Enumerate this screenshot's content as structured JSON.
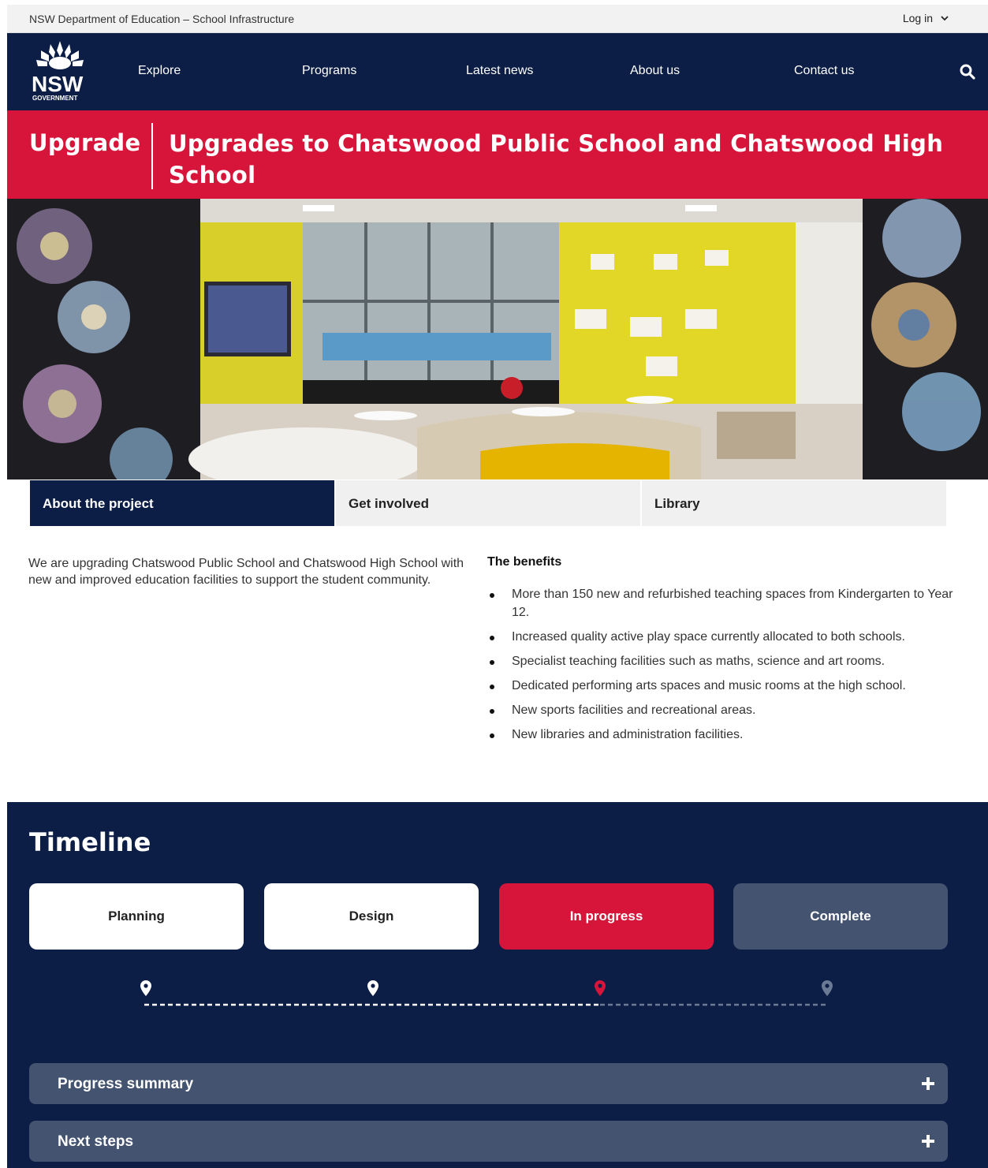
{
  "utility": {
    "org_name": "NSW Department of Education – School Infrastructure",
    "login_label": "Log in"
  },
  "brand": {
    "logo_text": "NSW",
    "logo_subtext": "GOVERNMENT"
  },
  "nav": {
    "items": [
      {
        "label": "Explore"
      },
      {
        "label": "Programs"
      },
      {
        "label": "Latest news"
      },
      {
        "label": "About us"
      },
      {
        "label": "Contact us"
      }
    ],
    "search_icon": "search-icon"
  },
  "banner": {
    "kicker": "Upgrade",
    "title": "Upgrades to Chatswood Public School and Chatswood High School"
  },
  "tabs": [
    {
      "label": "About the project",
      "active": true
    },
    {
      "label": "Get involved",
      "active": false
    },
    {
      "label": "Library",
      "active": false
    }
  ],
  "intro": "We are upgrading Chatswood Public School and Chatswood High School with new and improved education facilities to support the student community.",
  "benefits": {
    "heading": "The benefits",
    "items": [
      "More than 150 new and refurbished teaching spaces from Kindergarten to Year 12.",
      "Increased quality active play space currently allocated to both schools.",
      "Specialist teaching facilities such as maths, science and art rooms.",
      "Dedicated performing arts spaces and music rooms at the high school.",
      "New sports facilities and recreational areas.",
      "New libraries and administration facilities."
    ]
  },
  "timeline": {
    "heading": "Timeline",
    "stages": [
      {
        "label": "Planning",
        "status": "done"
      },
      {
        "label": "Design",
        "status": "done"
      },
      {
        "label": "In progress",
        "status": "current"
      },
      {
        "label": "Complete",
        "status": "future"
      }
    ],
    "accordions": [
      {
        "label": "Progress summary"
      },
      {
        "label": "Next steps"
      }
    ]
  },
  "colors": {
    "navy": "#0c1e45",
    "red": "#d7153a",
    "slate": "#435370"
  }
}
